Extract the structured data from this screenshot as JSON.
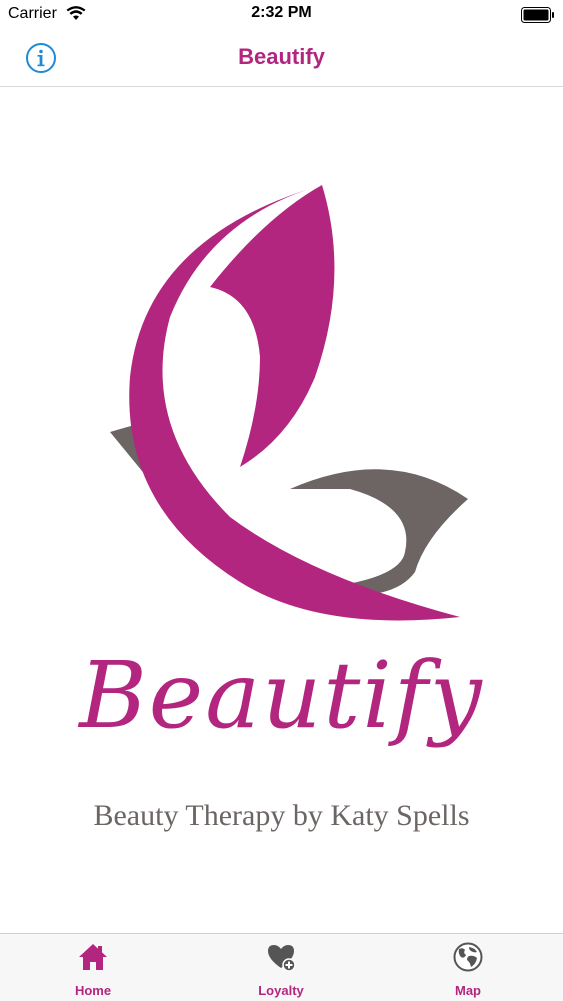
{
  "status_bar": {
    "carrier": "Carrier",
    "time": "2:32 PM"
  },
  "nav": {
    "title": "Beautify",
    "info_icon": "info-icon"
  },
  "logo": {
    "brand": "Beautify",
    "tagline": "Beauty Therapy by Katy Spells",
    "colors": {
      "pink": "#b2267f",
      "grey": "#6c6563"
    }
  },
  "tabs": [
    {
      "label": "Home",
      "icon": "house-icon",
      "selected": true
    },
    {
      "label": "Loyalty",
      "icon": "heart-plus-icon",
      "selected": false
    },
    {
      "label": "Map",
      "icon": "globe-icon",
      "selected": false
    }
  ]
}
